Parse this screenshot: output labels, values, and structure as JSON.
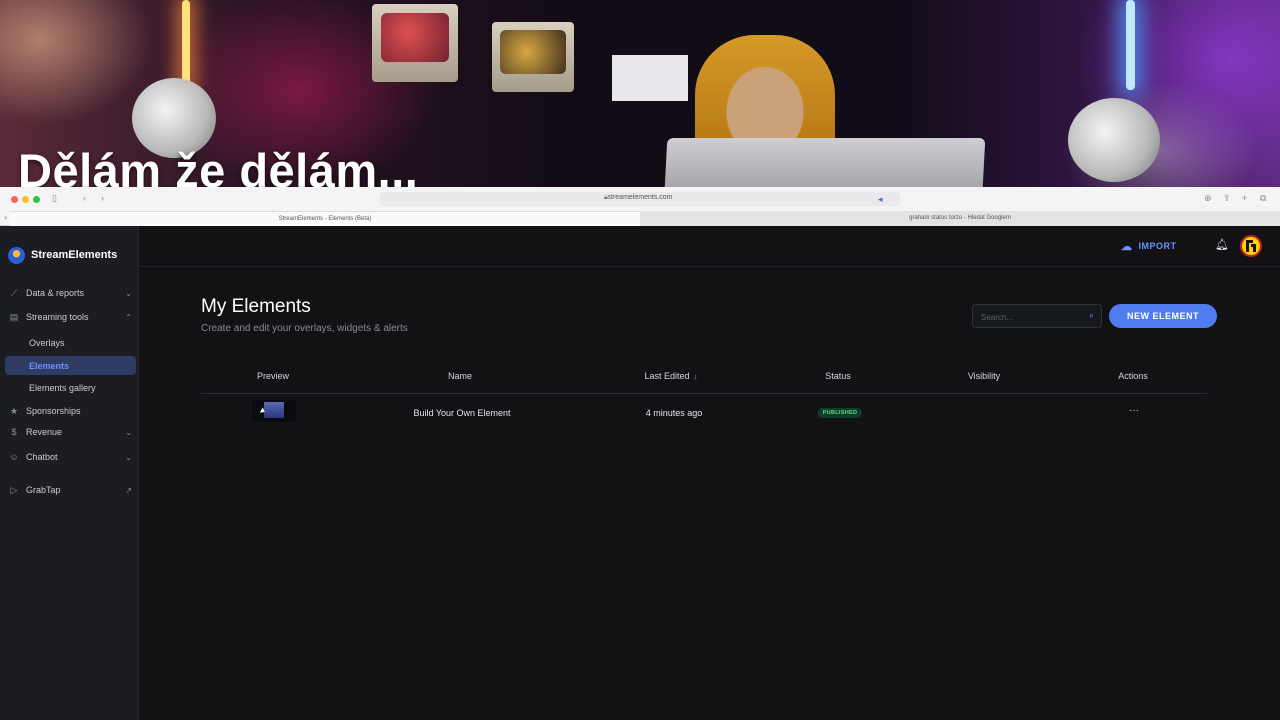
{
  "overlay": {
    "title": "Dělám že dělám..."
  },
  "browser": {
    "url": "streamelements.com",
    "tabs": [
      {
        "label": "StreamElements - Elements (Beta)"
      },
      {
        "label": "graham status torzo - Hledat Googlem"
      }
    ],
    "icons": {
      "sidebar_toggle": "sidebar-icon",
      "back": "chevron-left-icon",
      "forward": "chevron-right-icon",
      "audio": "speaker-icon",
      "download": "download-icon",
      "share": "share-icon",
      "new_tab": "plus-icon",
      "tab_overview": "tabs-icon"
    }
  },
  "app": {
    "brand": "StreamElements",
    "sidebar": {
      "items": [
        {
          "label": "Data & reports",
          "icon": "chart-line-icon",
          "expandable": true
        },
        {
          "label": "Streaming tools",
          "icon": "tools-icon",
          "expandable": true,
          "expanded": true
        },
        {
          "label": "Sponsorships",
          "icon": "star-icon"
        },
        {
          "label": "Revenue",
          "icon": "dollar-icon",
          "expandable": true
        },
        {
          "label": "Chatbot",
          "icon": "robot-icon",
          "expandable": true
        },
        {
          "label": "GrabTap",
          "icon": "play-icon",
          "external": true
        }
      ],
      "sub_items": [
        {
          "label": "Overlays"
        },
        {
          "label": "Elements",
          "active": true
        },
        {
          "label": "Elements gallery"
        }
      ]
    },
    "topbar": {
      "import_label": "IMPORT"
    },
    "page": {
      "title": "My Elements",
      "subtitle": "Create and edit your overlays, widgets & alerts",
      "search_placeholder": "Search...",
      "new_element_label": "NEW ELEMENT"
    },
    "table": {
      "columns": [
        "Preview",
        "Name",
        "Last Edited",
        "Status",
        "Visibility",
        "Actions"
      ],
      "sort_column": "Last Edited",
      "rows": [
        {
          "name": "Build Your Own Element",
          "last_edited": "4 minutes ago",
          "status": "PUBLISHED",
          "visibility": "",
          "actions": "···"
        }
      ]
    },
    "colors": {
      "accent": "#4f7df0",
      "published": "#4ce08a",
      "sidebar_bg": "#1c1d22",
      "main_bg": "#121215"
    }
  }
}
